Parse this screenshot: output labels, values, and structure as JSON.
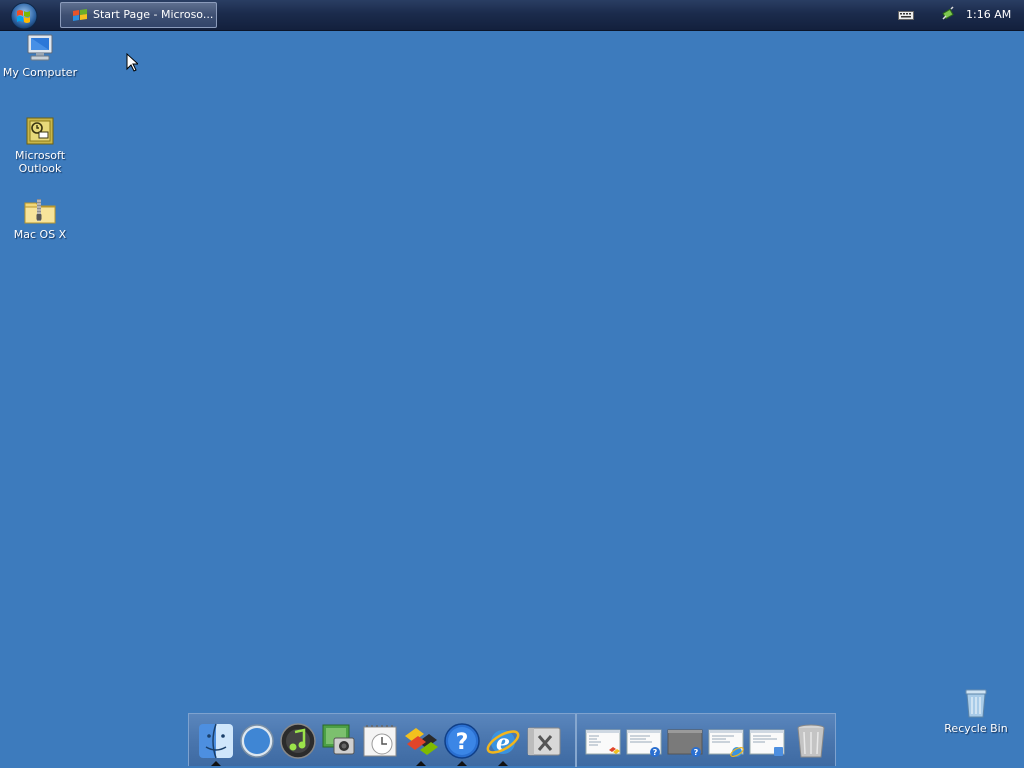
{
  "taskbar": {
    "active_task_label": "Start Page - Microso...",
    "clock": "1:16 AM"
  },
  "desktop": {
    "icons": [
      {
        "label": "My Computer",
        "icon": "my-computer-icon"
      },
      {
        "label": "Microsoft Outlook",
        "icon": "outlook-icon"
      },
      {
        "label": "Mac OS X",
        "icon": "zip-folder-icon"
      },
      {
        "label": "Recycle Bin",
        "icon": "recycle-bin-icon"
      }
    ]
  },
  "dock": {
    "apps": [
      "finder-icon",
      "safari-icon",
      "itunes-icon",
      "iphoto-icon",
      "ical-icon",
      "windows-flag-icon",
      "help-icon",
      "internet-explorer-icon",
      "utilities-icon"
    ],
    "minimized_windows": [
      "window-thumb-flag",
      "window-thumb-help",
      "window-thumb-help-dark",
      "window-thumb-ie",
      "window-thumb-finder"
    ],
    "trash": "trash-icon"
  },
  "colors": {
    "desktop": "#3d7bbd",
    "taskbar": "#1b2b4c",
    "dock": "#4a76ae"
  }
}
